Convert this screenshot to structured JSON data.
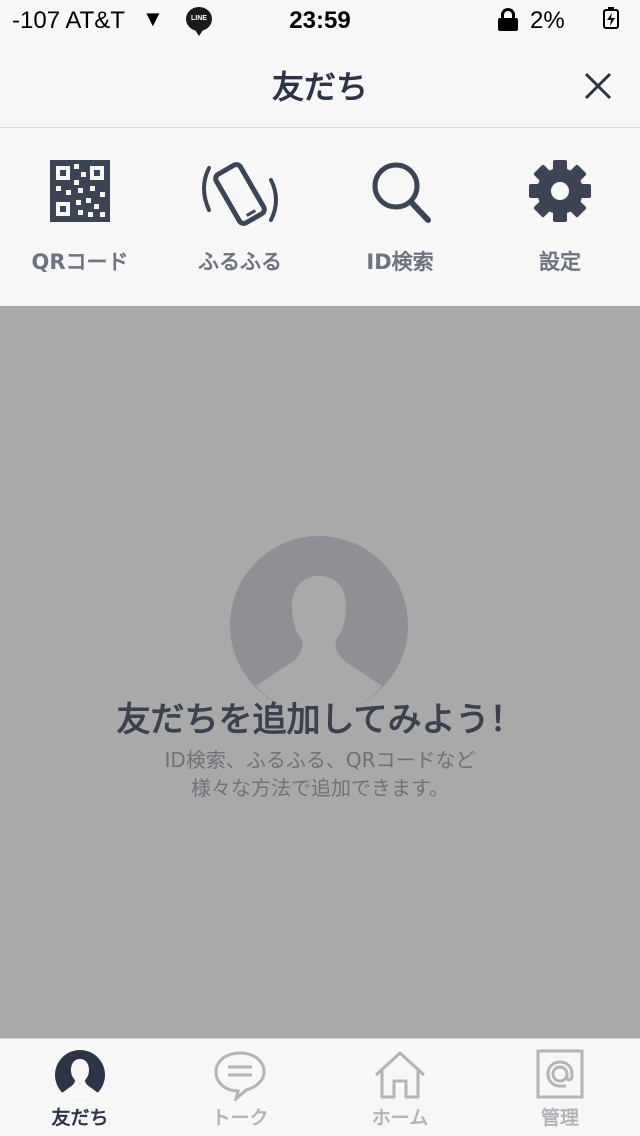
{
  "status_bar": {
    "carrier": "-107 AT&T",
    "line_badge": "LINE",
    "time": "23:59",
    "battery": "2%"
  },
  "header": {
    "title": "友だち"
  },
  "toolbar": {
    "items": [
      {
        "label": "QRコード",
        "icon": "qr-code-icon"
      },
      {
        "label": "ふるふる",
        "icon": "shake-phone-icon"
      },
      {
        "label": "ID検索",
        "icon": "search-icon"
      },
      {
        "label": "設定",
        "icon": "gear-icon"
      }
    ]
  },
  "empty_state": {
    "headline": "友だちを追加してみよう！",
    "line1": "ID検索、ふるふる、QRコードなど",
    "line2": "様々な方法で追加できます。"
  },
  "tabs": [
    {
      "label": "友だち",
      "icon": "person-icon",
      "active": true
    },
    {
      "label": "トーク",
      "icon": "chat-bubble-icon",
      "active": false
    },
    {
      "label": "ホーム",
      "icon": "home-icon",
      "active": false
    },
    {
      "label": "管理",
      "icon": "at-sign-icon",
      "active": false
    }
  ],
  "colors": {
    "accent": "#2d3447",
    "overlay": "#a9a9a9",
    "inactive_tab": "#b3b3b8"
  }
}
